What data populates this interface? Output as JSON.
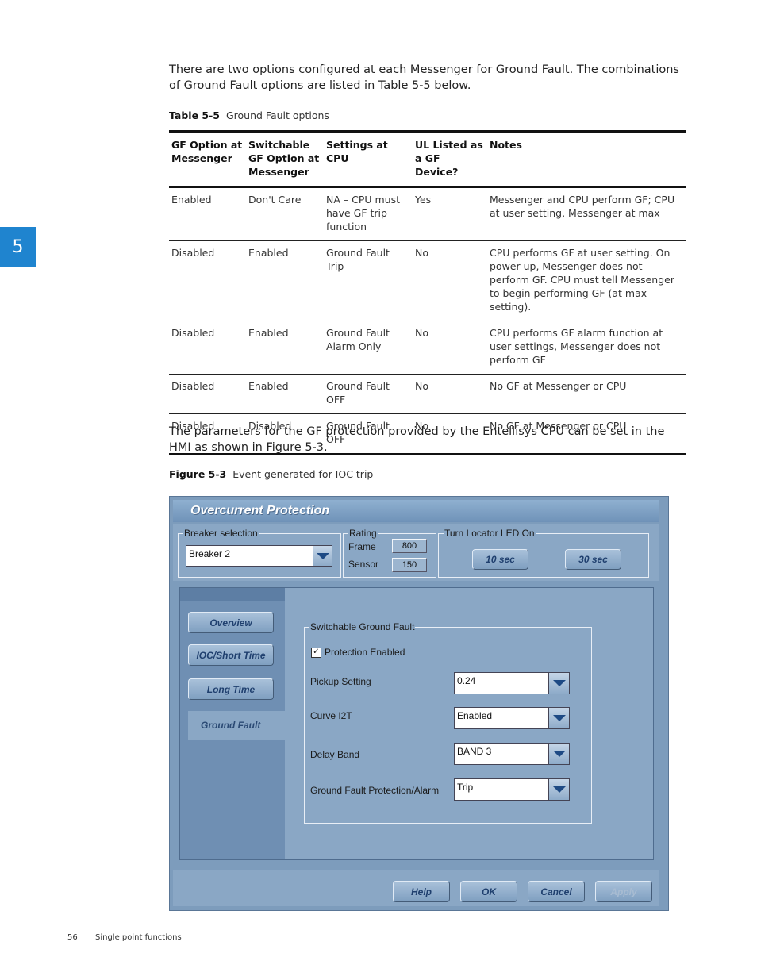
{
  "chapter_number": "5",
  "intro_paragraph": "There are two options configured at each Messenger for Ground Fault. The combinations of Ground Fault options are listed in Table 5-5 below.",
  "table_caption": {
    "label": "Table 5-5",
    "text": "Ground Fault options"
  },
  "table": {
    "headers": [
      "GF Option at Messenger",
      "Switchable GF Option at Messenger",
      "Settings at CPU",
      "UL Listed as a GF Device?",
      "Notes"
    ],
    "rows": [
      [
        "Enabled",
        "Don't Care",
        "NA – CPU must have GF trip function",
        "Yes",
        "Messenger and CPU perform GF; CPU at user setting, Messenger at max"
      ],
      [
        "Disabled",
        "Enabled",
        "Ground Fault Trip",
        "No",
        "CPU performs GF at user setting. On power up, Messenger does not perform GF. CPU must tell Messenger to begin performing GF (at max setting)."
      ],
      [
        "Disabled",
        "Enabled",
        "Ground Fault Alarm Only",
        "No",
        "CPU performs GF alarm function at user settings, Messenger does not perform GF"
      ],
      [
        "Disabled",
        "Enabled",
        "Ground Fault OFF",
        "No",
        "No GF at Messenger or CPU"
      ],
      [
        "Disabled",
        "Disabled",
        "Ground Fault OFF",
        "No",
        "No GF at Messenger or CPU"
      ]
    ]
  },
  "second_paragraph": "The parameters for the GF protection provided by the Entellisys CPU can be set in the HMI as shown in Figure 5-3.",
  "figure_caption": {
    "label": "Figure 5-3",
    "text": "Event generated for IOC trip"
  },
  "dialog": {
    "title": "Overcurrent Protection",
    "breaker_selection": {
      "label": "Breaker selection",
      "value": "Breaker 2"
    },
    "rating": {
      "label": "Rating",
      "frame_label": "Frame",
      "frame_value": "800",
      "sensor_label": "Sensor",
      "sensor_value": "150"
    },
    "locator": {
      "label": "Turn Locator LED On",
      "btn1": "10 sec",
      "btn2": "30 sec"
    },
    "nav": [
      "Overview",
      "IOC/Short Time",
      "Long Time",
      "Ground Fault"
    ],
    "group_label": "Switchable Ground Fault",
    "protection_enabled": {
      "label": "Protection Enabled",
      "checked": true
    },
    "settings": [
      {
        "label": "Pickup Setting",
        "value": "0.24"
      },
      {
        "label": "Curve I2T",
        "value": "Enabled"
      },
      {
        "label": "Delay Band",
        "value": "BAND 3"
      },
      {
        "label": "Ground Fault Protection/Alarm",
        "value": "Trip"
      }
    ],
    "buttons": {
      "help": "Help",
      "ok": "OK",
      "cancel": "Cancel",
      "apply": "Apply"
    }
  },
  "footer": {
    "page_number": "56",
    "section_title": "Single point functions"
  }
}
